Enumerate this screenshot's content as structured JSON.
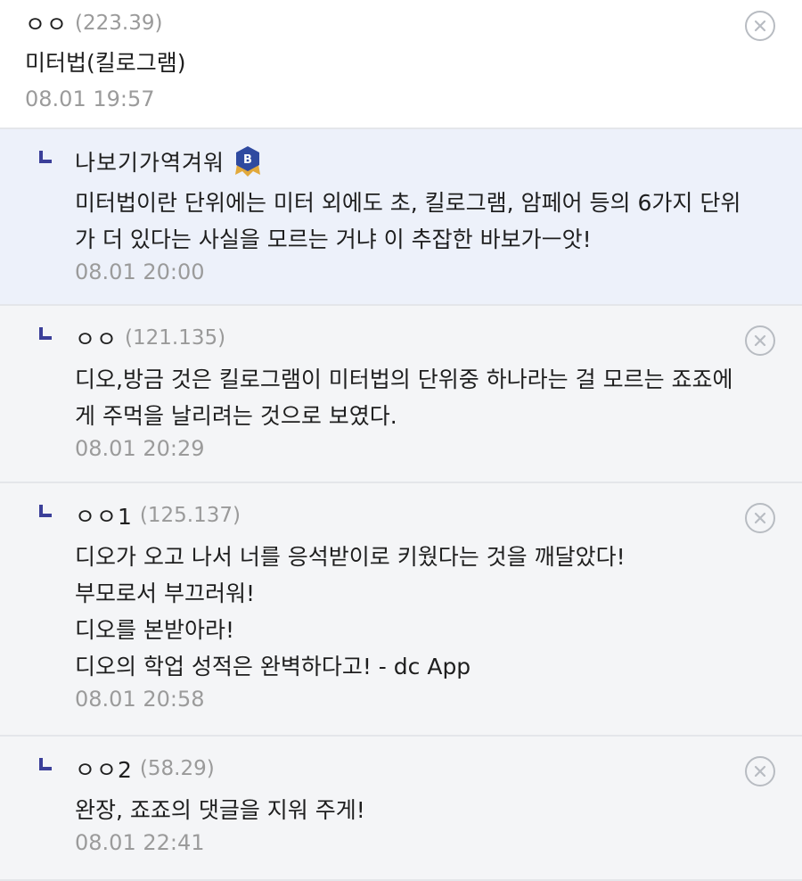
{
  "comments": [
    {
      "nick": "ㅇㅇ",
      "ip": "(223.39)",
      "text": "미터법(킬로그램)",
      "date": "08.01 19:57"
    },
    {
      "nick": "나보기가역겨워",
      "badge_letter": "B",
      "lines": [
        "미터법이란 단위에는 미터 외에도 초, 킬로그램, 암페어 등의 6가지 단위",
        "가 더 있다는 사실을 모르는 거냐 이 추잡한 바보가ㅡ앗!"
      ],
      "date": "08.01 20:00"
    },
    {
      "nick": "ㅇㅇ",
      "ip": "(121.135)",
      "lines": [
        "디오,방금 것은 킬로그램이 미터법의 단위중 하나라는 걸 모르는 죠죠에",
        "게 주먹을 날리려는 것으로 보였다."
      ],
      "date": "08.01 20:29"
    },
    {
      "nick": "ㅇㅇ1",
      "ip": "(125.137)",
      "lines": [
        "디오가 오고 나서 너를 응석받이로 키웠다는 것을 깨달았다!",
        "부모로서 부끄러워!",
        "디오를 본받아라!",
        "디오의 학업 성적은 완벽하다고! - dc App"
      ],
      "date": "08.01 20:58"
    },
    {
      "nick": "ㅇㅇ2",
      "ip": "(58.29)",
      "lines": [
        "완장, 죠죠의 댓글을 지워 주게!"
      ],
      "date": "08.01 22:41"
    }
  ],
  "colors": {
    "reply_mark": "#3b3f99",
    "best_bg": "#edf1fa",
    "reply_bg": "#f4f5f7",
    "badge_blue": "#2f4aa0",
    "badge_gold": "#e2a93b"
  },
  "icons": {
    "delete": "close-circle-icon",
    "badge": "best-badge-icon"
  }
}
